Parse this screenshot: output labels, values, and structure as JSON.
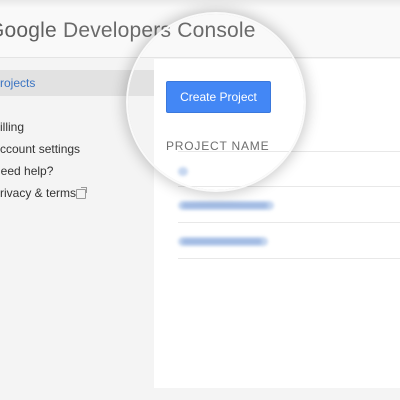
{
  "header": {
    "brand": "Google",
    "product": "Developers Console"
  },
  "sidebar": {
    "items": [
      {
        "label": "Projects",
        "active": true
      },
      {
        "label": "Billing"
      },
      {
        "label": "Account settings"
      },
      {
        "label": "Need help?"
      },
      {
        "label": "Privacy & terms",
        "icon": "external-link-icon"
      }
    ]
  },
  "main": {
    "create_button": "Create Project",
    "column_header": "PROJECT NAME"
  },
  "colors": {
    "accent": "#4387f5",
    "active_nav_text": "#3b74c2",
    "sidebar_bg": "#f4f4f4",
    "content_bg": "#ffffff"
  }
}
